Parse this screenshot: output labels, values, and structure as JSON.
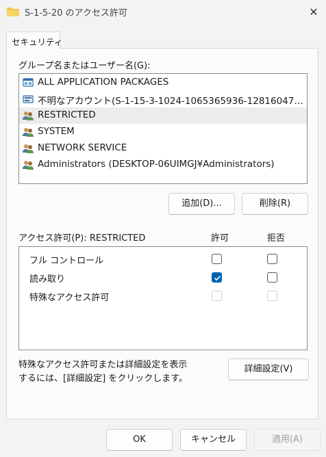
{
  "window": {
    "title": "S-1-5-20 のアクセス許可",
    "close_symbol": "✕"
  },
  "tabs": [
    {
      "label": "セキュリティ"
    }
  ],
  "principals": {
    "label": "グループ名またはユーザー名(G):",
    "items": [
      {
        "name": "ALL APPLICATION PACKAGES",
        "icon": "app-package-icon",
        "selected": false
      },
      {
        "name": "不明なアカウント(S-1-15-3-1024-1065365936-1281604716-3...",
        "icon": "unknown-account-icon",
        "selected": false
      },
      {
        "name": "RESTRICTED",
        "icon": "group-icon",
        "selected": true
      },
      {
        "name": "SYSTEM",
        "icon": "group-icon",
        "selected": false
      },
      {
        "name": "NETWORK SERVICE",
        "icon": "group-icon",
        "selected": false
      },
      {
        "name": "Administrators (DESKTOP-06UIMGJ¥Administrators)",
        "icon": "group-icon",
        "selected": false
      }
    ],
    "add_label": "追加(D)...",
    "remove_label": "削除(R)"
  },
  "permissions": {
    "label": "アクセス許可(P): RESTRICTED",
    "allow_header": "許可",
    "deny_header": "拒否",
    "rows": [
      {
        "name": "フル コントロール",
        "allow": false,
        "deny": false,
        "disabled": false
      },
      {
        "name": "読み取り",
        "allow": true,
        "deny": false,
        "disabled": false
      },
      {
        "name": "特殊なアクセス許可",
        "allow": false,
        "deny": false,
        "disabled": true
      }
    ]
  },
  "advanced": {
    "help_line1": "特殊なアクセス許可または詳細設定を表示",
    "help_line2": "するには、[詳細設定] をクリックします。",
    "button_label": "詳細設定(V)"
  },
  "footer": {
    "ok_label": "OK",
    "cancel_label": "キャンセル",
    "apply_label": "適用(A)"
  },
  "colors": {
    "accent": "#0063b1",
    "folder": "#f4c542"
  }
}
